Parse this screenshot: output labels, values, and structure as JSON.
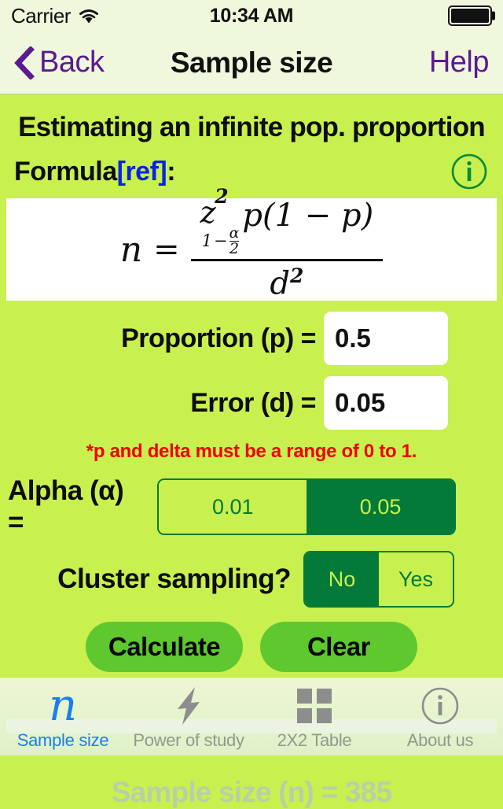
{
  "status_bar": {
    "carrier": "Carrier",
    "wifi_icon": "wifi-icon",
    "time": "10:34 AM",
    "battery_icon": "battery-full-icon"
  },
  "nav_bar": {
    "back_label": "Back",
    "back_icon": "chevron-left-icon",
    "title": "Sample size",
    "help_label": "Help"
  },
  "content": {
    "heading": "Estimating an infinite pop. proportion",
    "formula_label": "Formula",
    "formula_ref": "[ref]",
    "formula_colon": ":",
    "info_icon": "info-circle-icon",
    "formula": {
      "lhs": "n",
      "equals": "=",
      "numerator_z": "z",
      "numerator_z_exponent": "2",
      "numerator_sub_one": "1",
      "numerator_sub_minus": "−",
      "numerator_sub_alpha": "α",
      "numerator_sub_two": "2",
      "numerator_rest": "p(1 − p)",
      "denominator": "d",
      "denominator_exponent": "2"
    },
    "fields": [
      {
        "label": "Proportion (p) =",
        "value": "0.5",
        "placeholder": "p",
        "name": "proportion-input"
      },
      {
        "label": "Error (d) =",
        "value": "0.05",
        "placeholder": "d",
        "name": "error-input"
      }
    ],
    "warning": "*p and delta must be a range of 0 to 1.",
    "alpha": {
      "label": "Alpha (α) =",
      "options": [
        "0.01",
        "0.05"
      ],
      "selected": "0.05"
    },
    "cluster": {
      "label": "Cluster sampling?",
      "options": [
        "No",
        "Yes"
      ],
      "selected": "No"
    },
    "buttons": {
      "calculate": "Calculate",
      "clear": "Clear"
    },
    "result": "Sample size (n) = 385"
  },
  "tab_bar": {
    "items": [
      {
        "label": "Sample size",
        "icon": "n-italic-icon",
        "active": true
      },
      {
        "label": "Power of study",
        "icon": "lightning-bolt-icon",
        "active": false
      },
      {
        "label": "2X2 Table",
        "icon": "grid-2x2-icon",
        "active": false
      },
      {
        "label": "About us",
        "icon": "info-circle-icon",
        "active": false
      }
    ]
  },
  "colors": {
    "background": "#c8f04f",
    "bar_background": "#eff7dd",
    "accent_purple": "#5b1a8f",
    "dark_green": "#047a38",
    "button_green": "#5ec82e",
    "warning_red": "#f00000",
    "link_blue": "#0a22e8",
    "tab_active_blue": "#1a7ef0"
  }
}
